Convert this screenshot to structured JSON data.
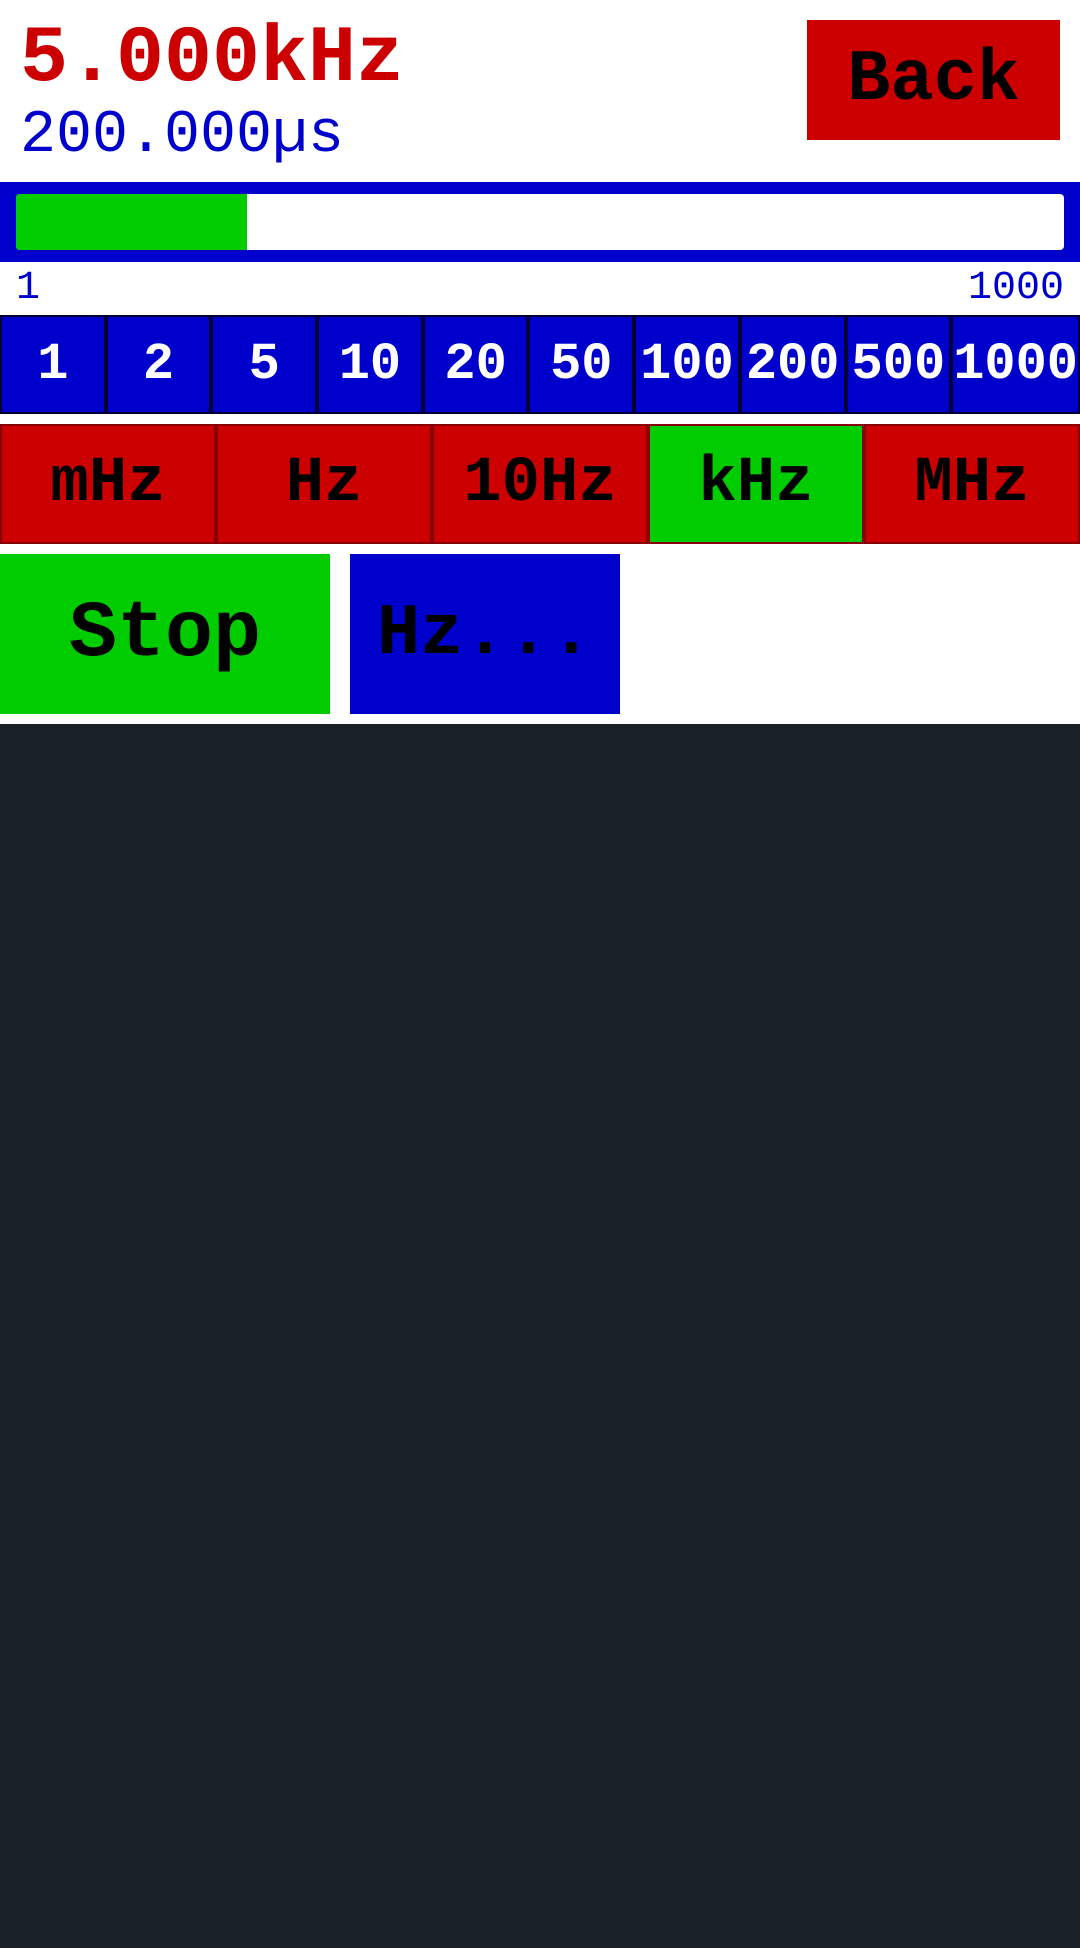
{
  "header": {
    "frequency": "5.000kHz",
    "period": "200.000µs",
    "back_label": "Back"
  },
  "progress_bar": {
    "fill_percent": 22,
    "range_min": "1",
    "range_max": "1000"
  },
  "multiplier_buttons": {
    "items": [
      {
        "label": "1",
        "value": 1
      },
      {
        "label": "2",
        "value": 2
      },
      {
        "label": "5",
        "value": 5
      },
      {
        "label": "10",
        "value": 10
      },
      {
        "label": "20",
        "value": 20
      },
      {
        "label": "50",
        "value": 50
      },
      {
        "label": "100",
        "value": 100
      },
      {
        "label": "200",
        "value": 200
      },
      {
        "label": "500",
        "value": 500
      },
      {
        "label": "1000",
        "value": 1000
      }
    ]
  },
  "unit_buttons": {
    "items": [
      {
        "label": "mHz",
        "active": false
      },
      {
        "label": "Hz",
        "active": false
      },
      {
        "label": "10Hz",
        "active": false
      },
      {
        "label": "kHz",
        "active": true
      },
      {
        "label": "MHz",
        "active": false
      }
    ]
  },
  "action_buttons": {
    "stop_label": "Stop",
    "hz_label": "Hz..."
  },
  "colors": {
    "red": "#cc0000",
    "blue": "#0000cc",
    "green": "#00cc00",
    "black": "#000000",
    "white": "#ffffff",
    "dark_bg": "#1a2228"
  }
}
